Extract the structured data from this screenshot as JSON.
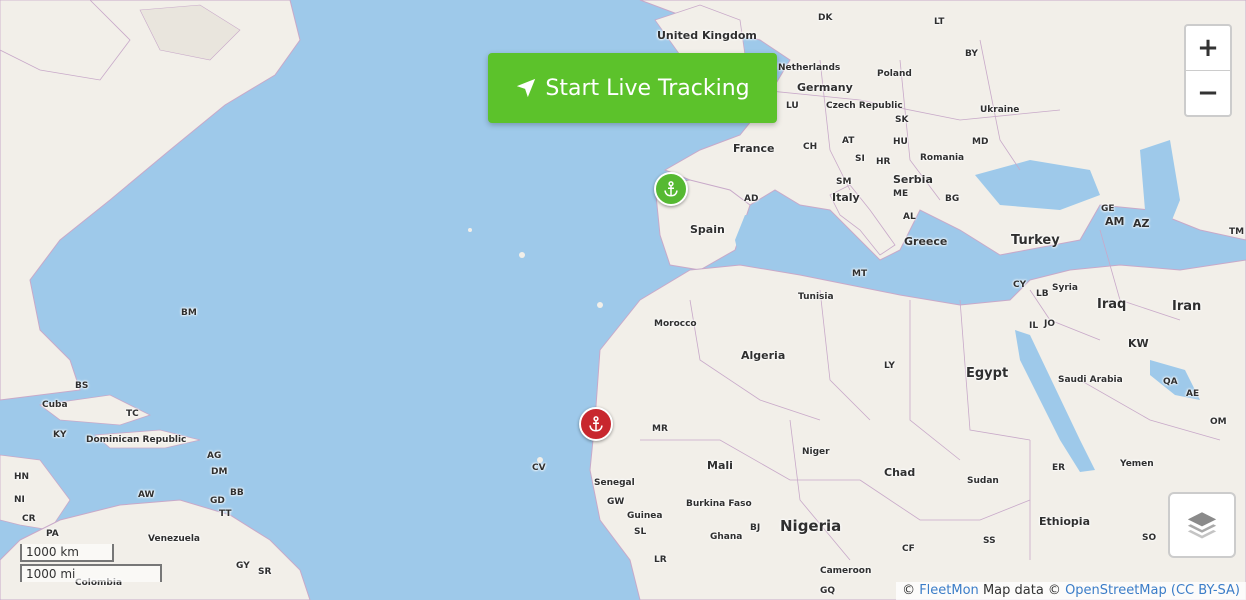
{
  "map": {
    "controls": {
      "start_tracking_label": "Start Live Tracking",
      "zoom_in_label": "+",
      "zoom_out_label": "−",
      "layers_icon": "layers-icon"
    },
    "markers": [
      {
        "name": "port-marker-green",
        "color": "#56b932",
        "icon": "anchor-icon"
      },
      {
        "name": "port-marker-red",
        "color": "#c8272e",
        "icon": "anchor-icon"
      }
    ],
    "scale": {
      "metric": "1000 km",
      "imperial": "1000 mi"
    },
    "attribution": {
      "prefix": "©",
      "fleetmon": "FleetMon",
      "map_data": "Map data ©",
      "osm": "OpenStreetMap",
      "license": "(CC BY-SA)"
    },
    "labels": {
      "united_kingdom": "United Kingdom",
      "dk": "DK",
      "lt": "LT",
      "by": "BY",
      "netherlands": "Netherlands",
      "germany": "Germany",
      "poland": "Poland",
      "lu": "LU",
      "czech_republic": "Czech Republic",
      "sk": "SK",
      "ukraine": "Ukraine",
      "france": "France",
      "ch": "CH",
      "at": "AT",
      "hu": "HU",
      "md": "MD",
      "si": "SI",
      "hr": "HR",
      "romania": "Romania",
      "sm": "SM",
      "serbia": "Serbia",
      "italy": "Italy",
      "me": "ME",
      "bg": "BG",
      "ad": "AD",
      "al": "AL",
      "spain": "Spain",
      "greece": "Greece",
      "turkey": "Turkey",
      "ge": "GE",
      "am": "AM",
      "az": "AZ",
      "tm": "TM",
      "mt": "MT",
      "tunisia": "Tunisia",
      "cy": "CY",
      "lb": "LB",
      "syria": "Syria",
      "iraq": "Iraq",
      "iran": "Iran",
      "il": "IL",
      "jo": "JO",
      "morocco": "Morocco",
      "kw": "KW",
      "algeria": "Algeria",
      "ly": "LY",
      "egypt": "Egypt",
      "saudi_arabia": "Saudi Arabia",
      "qa": "QA",
      "ae": "AE",
      "om": "OM",
      "bm": "BM",
      "bs": "BS",
      "cuba": "Cuba",
      "tc": "TC",
      "ky": "KY",
      "dominican_republic": "Dominican Republic",
      "ag": "AG",
      "dm": "DM",
      "bb": "BB",
      "gd": "GD",
      "tt": "TT",
      "hn": "HN",
      "ni": "NI",
      "cr": "CR",
      "pa": "PA",
      "aw": "AW",
      "venezuela": "Venezuela",
      "gy": "GY",
      "sr": "SR",
      "colombia": "Colombia",
      "mr": "MR",
      "cv": "CV",
      "mali": "Mali",
      "niger": "Niger",
      "chad": "Chad",
      "sudan": "Sudan",
      "er": "ER",
      "yemen": "Yemen",
      "senegal": "Senegal",
      "gw": "GW",
      "guinea": "Guinea",
      "sl": "SL",
      "burkina_faso": "Burkina Faso",
      "bj": "BJ",
      "ghana": "Ghana",
      "nigeria": "Nigeria",
      "lr": "LR",
      "cf": "CF",
      "ss": "SS",
      "ethiopia": "Ethiopia",
      "so": "SO",
      "cameroon": "Cameroon",
      "gq": "GQ"
    },
    "colors": {
      "ocean": "#9ec9ea",
      "land": "#f2efe9",
      "border": "#c8a9c9",
      "tracking_button": "#5cc22b"
    }
  }
}
